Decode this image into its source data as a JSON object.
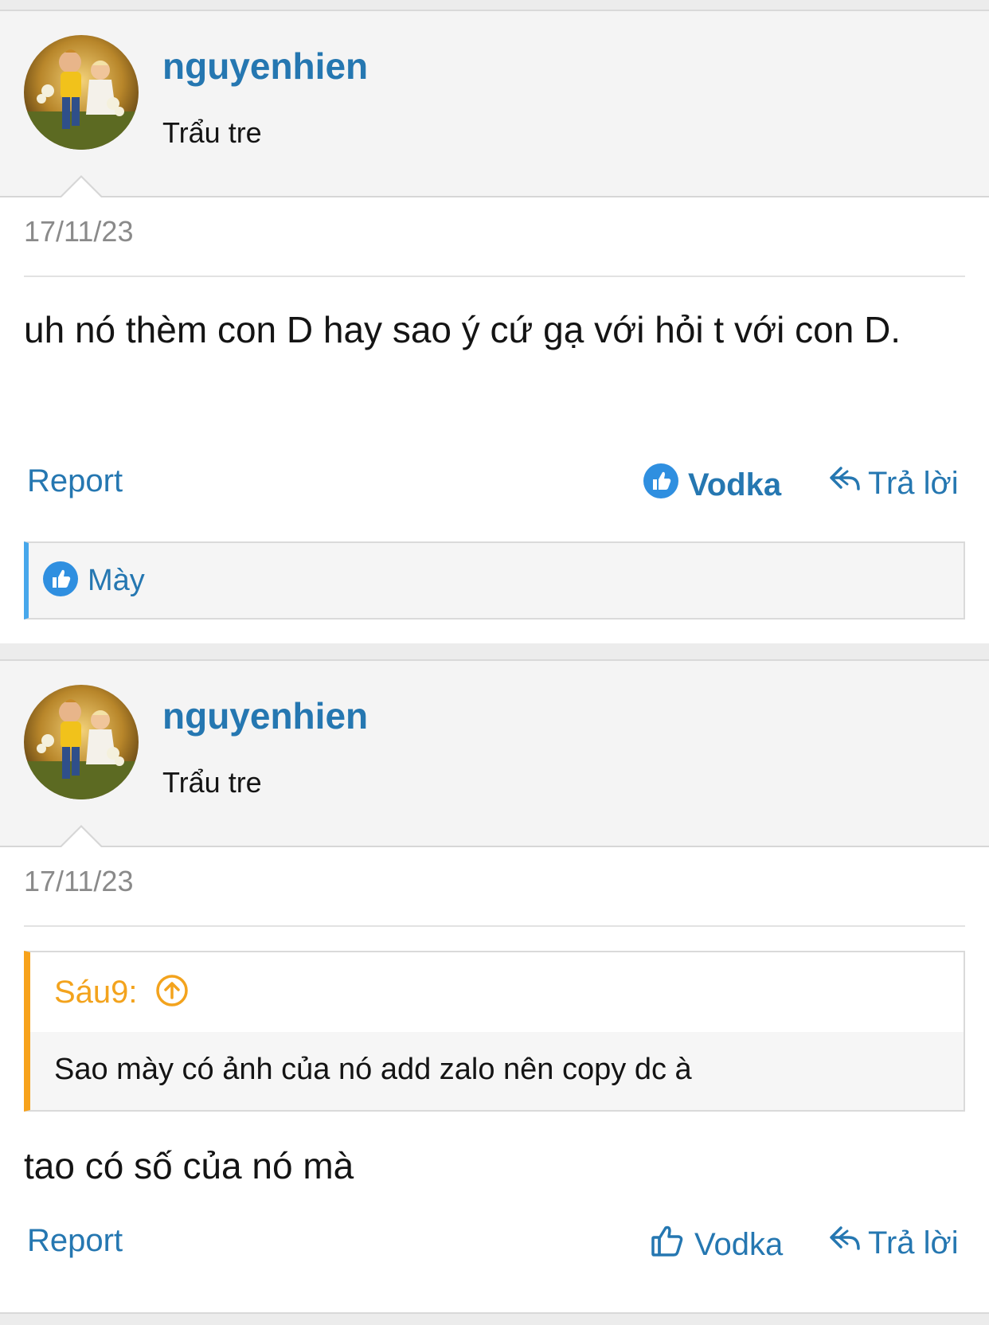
{
  "posts": [
    {
      "username": "nguyenhien",
      "user_title": "Trẩu tre",
      "date": "17/11/23",
      "message": "uh nó thèm con D hay sao ý cứ gạ với hỏi t với con D.",
      "actions": {
        "report": "Report",
        "like": "Vodka",
        "reply": "Trả lời"
      },
      "reactions": {
        "label": "Mày"
      }
    },
    {
      "username": "nguyenhien",
      "user_title": "Trẩu tre",
      "date": "17/11/23",
      "quote": {
        "author": "Sáu9:",
        "text": "Sao mày có ảnh của nó add zalo nên copy dc à"
      },
      "message": "tao có số của nó mà",
      "actions": {
        "report": "Report",
        "like": "Vodka",
        "reply": "Trả lời"
      }
    }
  ],
  "colors": {
    "link": "#2577b1",
    "quote_accent": "#f7a21b",
    "reaction_accent": "#47a7eb"
  }
}
